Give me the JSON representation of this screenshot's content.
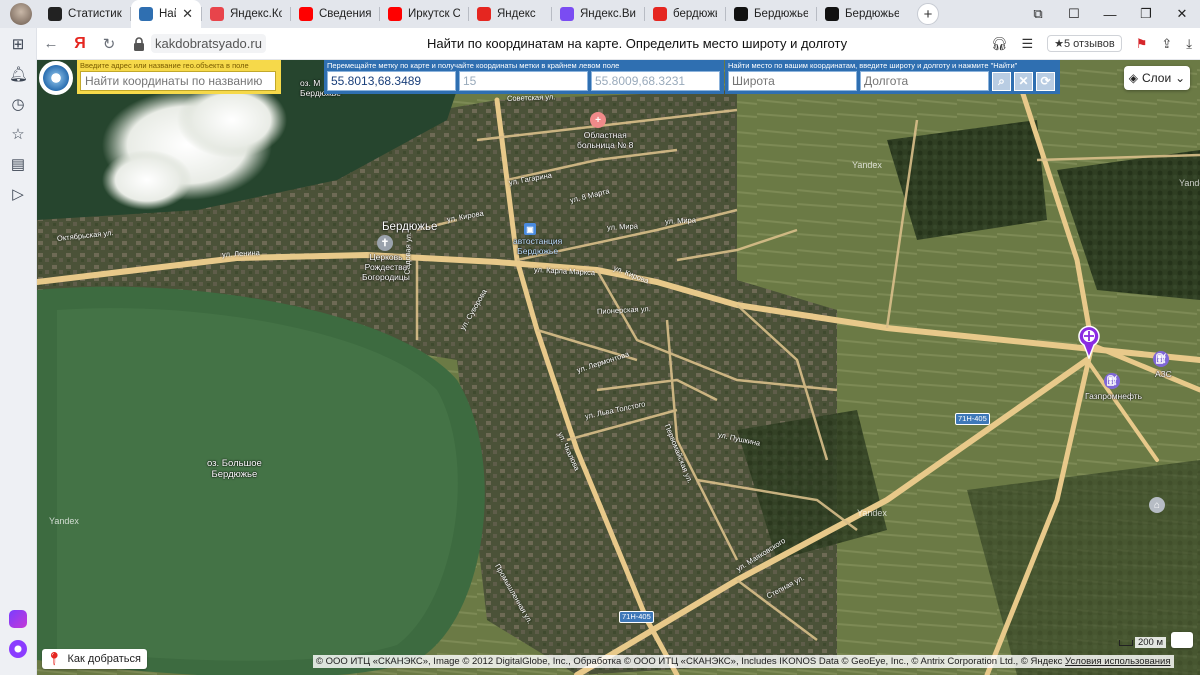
{
  "browser": {
    "tabs": [
      {
        "label": "Статистика",
        "icon": "plus-square-icon",
        "color": "#222222"
      },
      {
        "label": "Найти по",
        "icon": "sun-logo-icon",
        "color": "#2f6fb1",
        "active": true
      },
      {
        "label": "Яндекс.Колл",
        "icon": "collections-icon",
        "color": "#e8444b"
      },
      {
        "label": "Сведения о",
        "icon": "youtube-icon",
        "color": "#ff0000"
      },
      {
        "label": "Иркутск Сми",
        "icon": "youtube-icon",
        "color": "#ff0000"
      },
      {
        "label": "Яндекс",
        "icon": "yandex-icon",
        "color": "#e52620"
      },
      {
        "label": "Яндекс.Виде",
        "icon": "video-icon",
        "color": "#7a4cf2"
      },
      {
        "label": "бердюжье т",
        "icon": "yandex-icon",
        "color": "#e52620"
      },
      {
        "label": "Бердюжье (",
        "icon": "wikipedia-w2-icon",
        "color": "#111111"
      },
      {
        "label": "Бердюжье (",
        "icon": "wikipedia-icon",
        "color": "#111111"
      }
    ],
    "new_tab": "+",
    "address": {
      "domain": "kakdobratsyado.ru",
      "page_title": "Найти по координатам на карте. Определить место широту и долготу",
      "reviews": "★5 отзывов"
    }
  },
  "panel": {
    "search_caption": "Введите адрес или название гео.объекта в поле",
    "search_placeholder": "Найти координаты по названию",
    "coords_caption": "Перемещайте метку по карте и получайте координаты метки в крайнем левом поле",
    "marker_coords": "55.8013,68.3489",
    "zoom": "15",
    "center_coords": "55.8009,68.3231",
    "find_caption": "Найти место по вашим координатам, введите широту и долготу и нажмите \"Найти\"",
    "lat_placeholder": "Широта",
    "lon_placeholder": "Долгота",
    "layers_label": "Слои"
  },
  "map": {
    "labels": {
      "village": "Бердюжье",
      "lake": "оз. Большое\nБердюжье",
      "lake_top": "оз. М\nБердюжье",
      "hospital": "Областная\nбольница № 8",
      "bus_station": "автостанция\nБердюжье",
      "church": "Церковь\nРождества\nБогородицы",
      "gas_station_1": "АЗС",
      "gas_station_2": "Газпромнефть"
    },
    "streets": {
      "lenina": "ул. Ленина",
      "oktyabrskaya": "Октябрьская ул.",
      "kirova1": "ул. Кирова",
      "kirova2": "ул. Кирова",
      "gagarina": "ул. Гагарина",
      "marta": "ул. 8 Марта",
      "mira1": "ул. Мира",
      "mira2": "ул. Мира",
      "karla_marksa": "ул. Карла Маркса",
      "sovetskaya": "Советская ул.",
      "pionerskaya": "Пионерская ул.",
      "lermontova": "ул. Лермонтова",
      "lva_tolstogo": "ул. Льва Толстого",
      "chkalova": "ул. Чкалова",
      "pushkina": "ул. Пушкина",
      "mayakovskogo": "ул. Маяковского",
      "stepnaya": "Степная ул.",
      "suvorova": "ул. Суворова",
      "pervomayskaya": "Первомайская ул.",
      "promyshlennaya": "Промышленная ул.",
      "sadovaya": "Садовая ул."
    },
    "highway_1": "71Н-405",
    "highway_2": "71Н-405",
    "watermark": "Yandex",
    "scale": "200 м",
    "how_to_get": "Как добраться",
    "copyright": "© ООО ИТЦ «СКАНЭКС», Image © 2012 DigitalGlobe, Inc., Обработка © ООО ИТЦ «СКАНЭКС», Includes IKONOS Data © GeoEye, Inc., © Antrix Corporation Ltd., © Яндекс",
    "terms": "Условия использования"
  }
}
